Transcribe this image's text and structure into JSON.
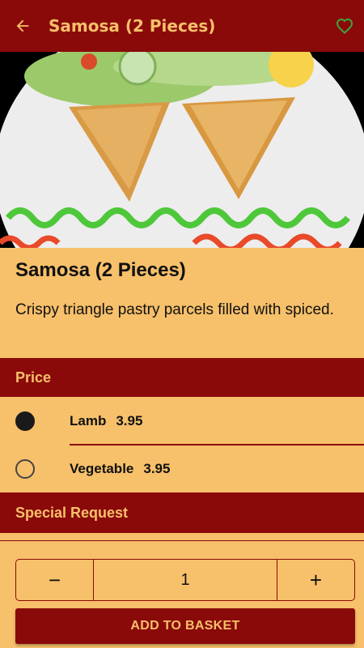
{
  "appbar": {
    "title": "Samosa (2 Pieces)",
    "back_icon": "arrow-left-icon",
    "favorite_icon": "heart-outline-icon"
  },
  "item": {
    "title": "Samosa (2 Pieces)",
    "description": "Crispy triangle pastry parcels filled with spiced."
  },
  "price_section": {
    "label": "Price",
    "options": [
      {
        "name": "Lamb",
        "price": "3.95",
        "selected": true
      },
      {
        "name": "Vegetable",
        "price": "3.95",
        "selected": false
      }
    ]
  },
  "special_request": {
    "label": "Special Request"
  },
  "quantity": {
    "value": "1",
    "minus": "−",
    "plus": "+"
  },
  "add_to_basket": {
    "label": "ADD TO BASKET"
  },
  "colors": {
    "primary": "#8a0a0a",
    "background": "#f7c06a",
    "favorite": "#3aa83a"
  }
}
